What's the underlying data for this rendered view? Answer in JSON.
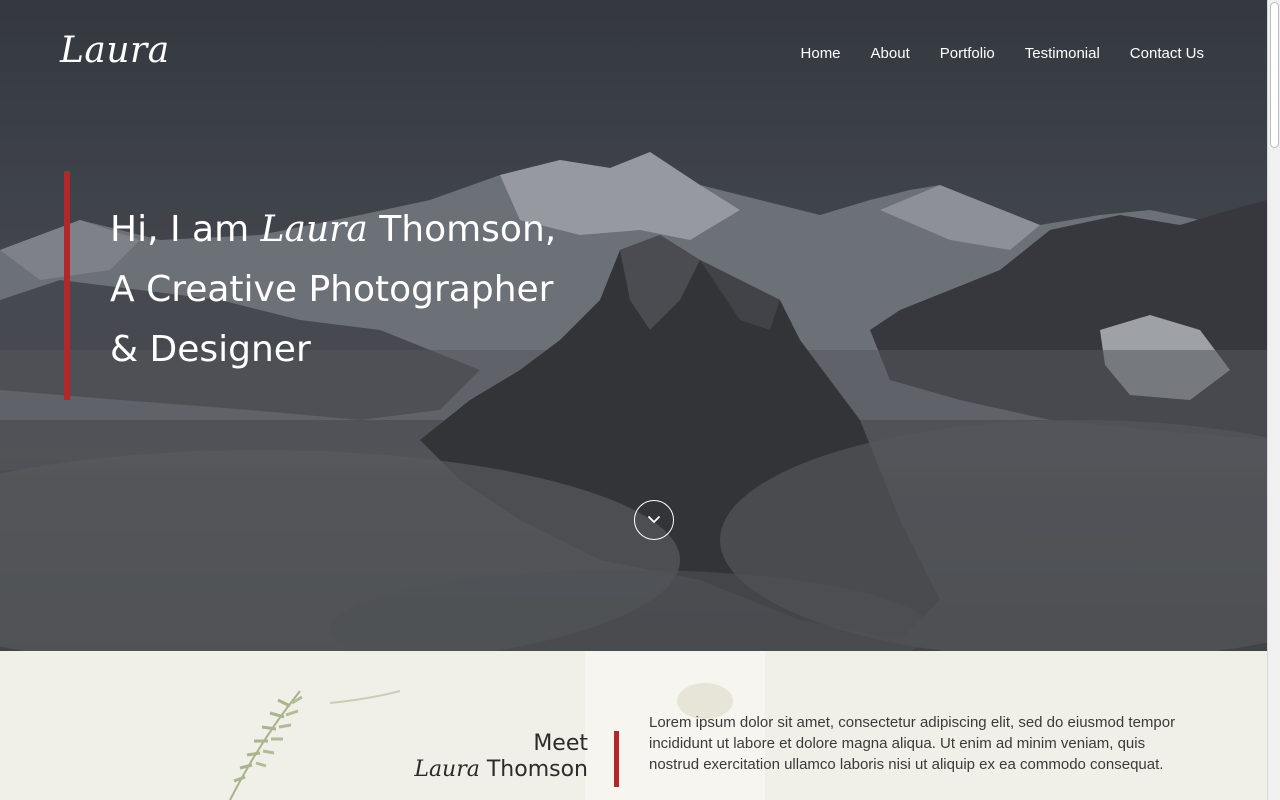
{
  "header": {
    "logo": "Laura",
    "nav": [
      "Home",
      "About",
      "Portfolio",
      "Testimonial",
      "Contact Us"
    ]
  },
  "hero": {
    "greeting_prefix": "Hi, I am ",
    "greeting_script": "Laura",
    "greeting_suffix": " Thomson,",
    "line2": "A Creative Photographer",
    "line3": "& Designer",
    "scroll_icon": "chevron-down-icon"
  },
  "about": {
    "meet": "Meet",
    "name_script": "Laura",
    "name_rest": " Thomson",
    "body": "Lorem ipsum dolor sit amet, consectetur adipiscing elit, sed do eiusmod tempor incididunt ut labore et dolore magna aliqua. Ut enim ad minim veniam, quis nostrud exercitation ullamco laboris nisi ut aliquip ex ea commodo consequat."
  },
  "colors": {
    "accent": "#b3262a",
    "hero_overlay": "#3c4047",
    "about_bg": "#f0efe8"
  }
}
